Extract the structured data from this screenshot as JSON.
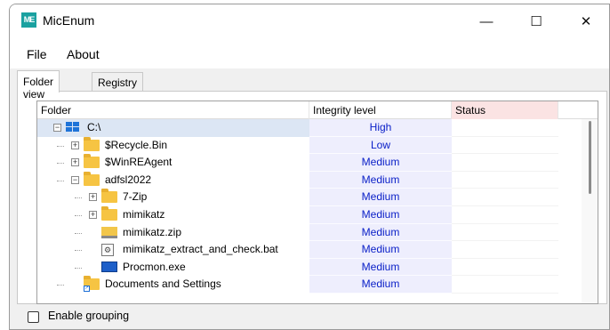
{
  "window": {
    "title": "MicEnum",
    "icon_text": "ME",
    "controls": {
      "minimize": "—",
      "maximize": "☐",
      "close": "✕"
    }
  },
  "menu": [
    "File",
    "About"
  ],
  "tabs": [
    {
      "label": "Folder view",
      "active": true
    },
    {
      "label": "Registry view",
      "active": false
    }
  ],
  "grid": {
    "columns": [
      "Folder",
      "Integrity level",
      "Status"
    ],
    "status_header_color": "#fbe3e3",
    "integrity_color": "#0b20c8",
    "rows": [
      {
        "name": "C:\\",
        "integrity": "High",
        "status": "",
        "depth": 0,
        "expander": "−",
        "icon": "drive-icon"
      },
      {
        "name": "$Recycle.Bin",
        "integrity": "Low",
        "status": "",
        "depth": 1,
        "expander": "+",
        "icon": "folder-icon"
      },
      {
        "name": "$WinREAgent",
        "integrity": "Medium",
        "status": "",
        "depth": 1,
        "expander": "+",
        "icon": "folder-icon"
      },
      {
        "name": "adfsl2022",
        "integrity": "Medium",
        "status": "",
        "depth": 1,
        "expander": "−",
        "icon": "folder-icon"
      },
      {
        "name": "7-Zip",
        "integrity": "Medium",
        "status": "",
        "depth": 2,
        "expander": "+",
        "icon": "folder-icon"
      },
      {
        "name": "mimikatz",
        "integrity": "Medium",
        "status": "",
        "depth": 2,
        "expander": "+",
        "icon": "folder-icon"
      },
      {
        "name": "mimikatz.zip",
        "integrity": "Medium",
        "status": "",
        "depth": 2,
        "expander": "",
        "icon": "zip-icon"
      },
      {
        "name": "mimikatz_extract_and_check.bat",
        "integrity": "Medium",
        "status": "",
        "depth": 2,
        "expander": "",
        "icon": "bat-icon"
      },
      {
        "name": "Procmon.exe",
        "integrity": "Medium",
        "status": "",
        "depth": 2,
        "expander": "",
        "icon": "exe-icon"
      },
      {
        "name": "Documents and Settings",
        "integrity": "Medium",
        "status": "",
        "depth": 1,
        "expander": "",
        "icon": "folder-shortcut-icon"
      }
    ]
  },
  "options": {
    "enable_grouping_label": "Enable grouping",
    "enable_grouping_checked": false
  }
}
